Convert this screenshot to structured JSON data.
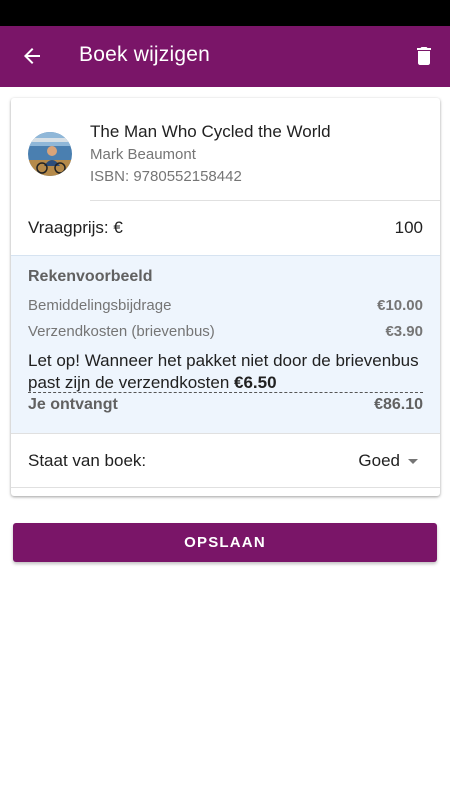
{
  "theme": {
    "primary": "#7a1568",
    "status_bar": "#000000",
    "calc_background": "#eef5fd"
  },
  "app_bar": {
    "title": "Boek wijzigen",
    "back_icon": "arrow-left-icon",
    "delete_icon": "trash-icon"
  },
  "book": {
    "title": "The Man Who Cycled the World",
    "author": "Mark Beaumont",
    "isbn": "ISBN: 9780552158442",
    "cover_icon": "book-cover-thumbnail"
  },
  "price": {
    "label": "Vraagprijs: €",
    "value": "100"
  },
  "calculation": {
    "heading": "Rekenvoorbeeld",
    "rows": [
      {
        "label": "Bemiddelingsbijdrage",
        "value": "€10.00"
      },
      {
        "label": "Verzendkosten (brievenbus)",
        "value": "€3.90"
      }
    ],
    "notice_text": "Let op! Wanneer het pakket niet door de brievenbus past zijn de verzendkosten ",
    "notice_amount": "€6.50",
    "receive_label": "Je ontvangt",
    "receive_value": "€86.10"
  },
  "condition": {
    "label": "Staat van boek:",
    "selected": "Goed",
    "caret_icon": "caret-down-icon"
  },
  "save_button": {
    "label": "OPSLAAN"
  }
}
